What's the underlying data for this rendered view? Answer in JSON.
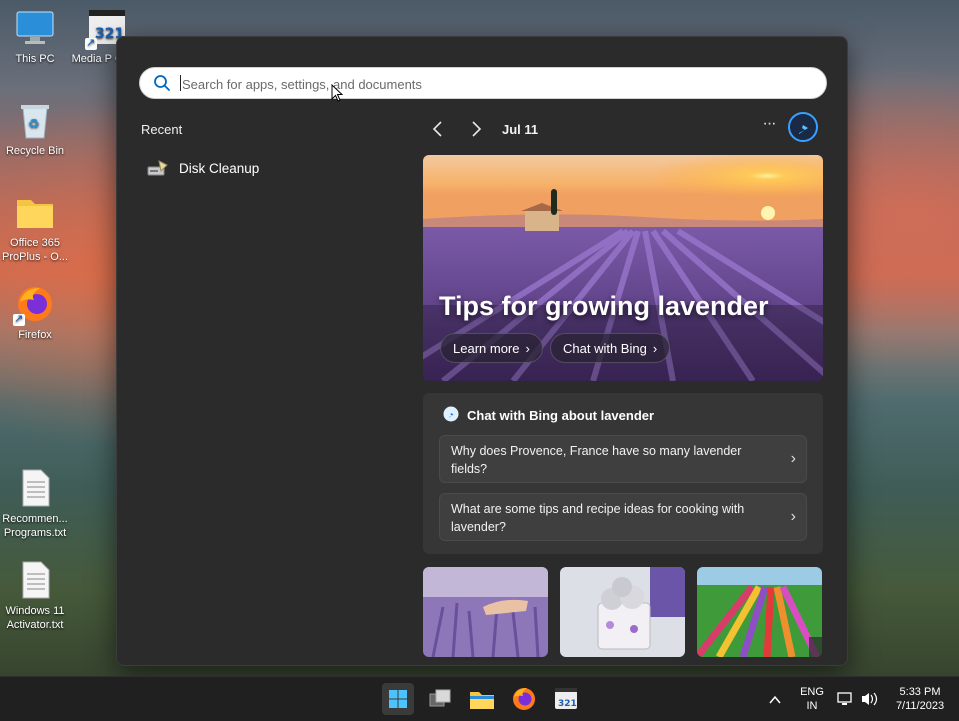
{
  "desktop": {
    "icons": [
      {
        "label": "This PC"
      },
      {
        "label": "Media P Class"
      },
      {
        "label": "Recycle Bin"
      },
      {
        "label": "Office 365 ProPlus - O..."
      },
      {
        "label": "Firefox"
      },
      {
        "label": "Recommen... Programs.txt"
      },
      {
        "label": "Windows 11 Activator.txt"
      }
    ]
  },
  "search": {
    "placeholder": "Search for apps, settings, and documents",
    "value": ""
  },
  "recent": {
    "title": "Recent",
    "items": [
      {
        "label": "Disk Cleanup",
        "icon": "disk-cleanup-icon"
      }
    ]
  },
  "highlights": {
    "date": "Jul 11",
    "prev_label": "‹",
    "next_label": "›",
    "more_label": "···",
    "hero": {
      "title": "Tips for growing lavender",
      "learn_more": "Learn more",
      "chat_with_bing": "Chat with Bing"
    },
    "bing_card": {
      "title": "Chat with Bing about lavender",
      "questions": [
        "Why does Provence, France have so many lavender fields?",
        "What are some tips and recipe ideas for cooking with lavender?"
      ]
    }
  },
  "taskbar": {
    "language": "ENG",
    "region": "IN",
    "time": "5:33 PM",
    "date": "7/11/2023",
    "tray_expand": "^"
  },
  "colors": {
    "panel_bg": "#2b2b2b",
    "card_bg": "#363636",
    "taskbar_bg": "#202020",
    "accent": "#0067c0"
  }
}
